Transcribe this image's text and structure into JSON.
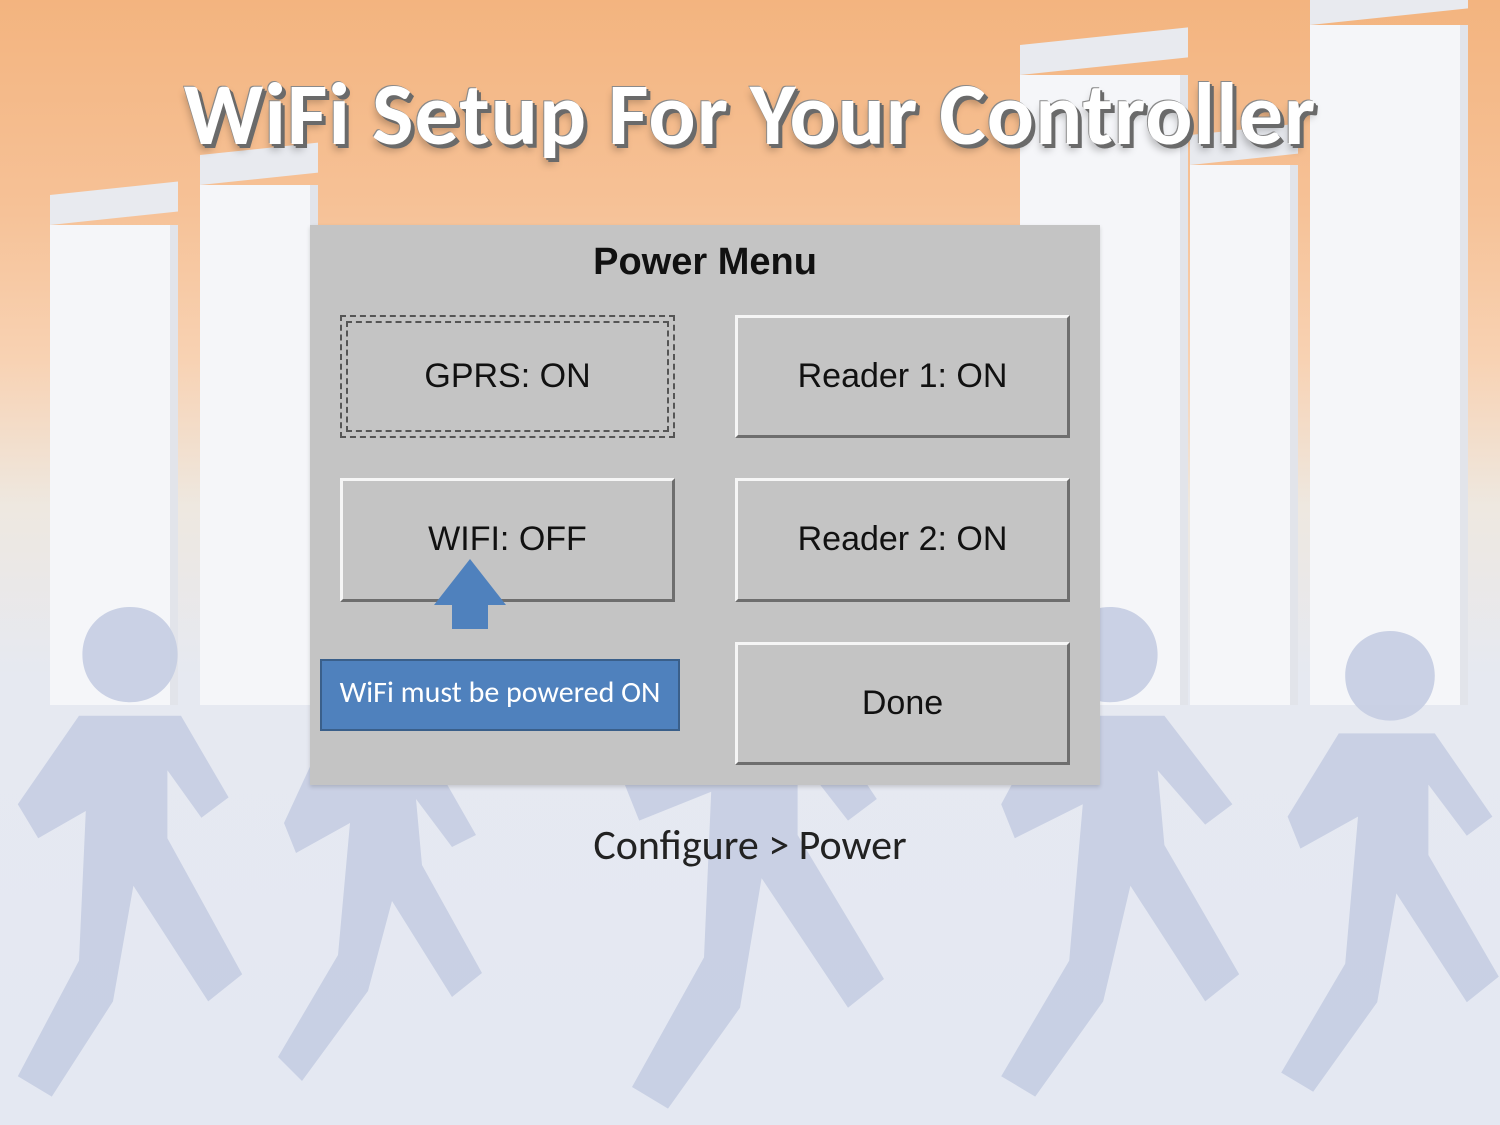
{
  "title": "WiFi Setup For Your Controller",
  "panel": {
    "title": "Power Menu",
    "gprs_label": "GPRS: ON",
    "wifi_label": "WIFI: OFF",
    "reader1_label": "Reader 1: ON",
    "reader2_label": "Reader 2: ON",
    "done_label": "Done"
  },
  "callout": {
    "text": "WiFi must be powered ON"
  },
  "breadcrumb": "Configure > Power"
}
